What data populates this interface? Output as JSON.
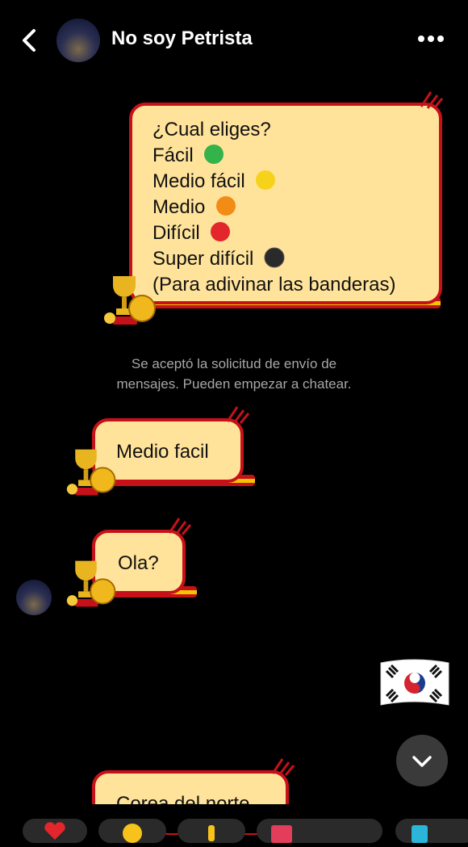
{
  "header": {
    "contact_name": "No soy Petrista"
  },
  "messages": {
    "options_lines": [
      "¿Cual eliges?",
      "Fácil",
      "Medio fácil",
      "Medio",
      "Difícil",
      "Super difícil",
      "(Para adivinar las banderas)"
    ],
    "option_dot_colors": [
      "#34b34a",
      "#f6d21b",
      "#f28c15",
      "#e2262c",
      "#2a2a2a"
    ],
    "system_notice_line1": "Se aceptó la solicitud de envío de",
    "system_notice_line2": "mensajes. Pueden empezar a chatear.",
    "reply1": "Medio facil",
    "reply2": "Ola?",
    "last_partial": "Corea del norte"
  },
  "flag": {
    "name": "South Korea flag"
  },
  "colors": {
    "bubble_fill": "#ffe39a",
    "bubble_border": "#c6111a",
    "accent_gold": "#f3c500"
  }
}
